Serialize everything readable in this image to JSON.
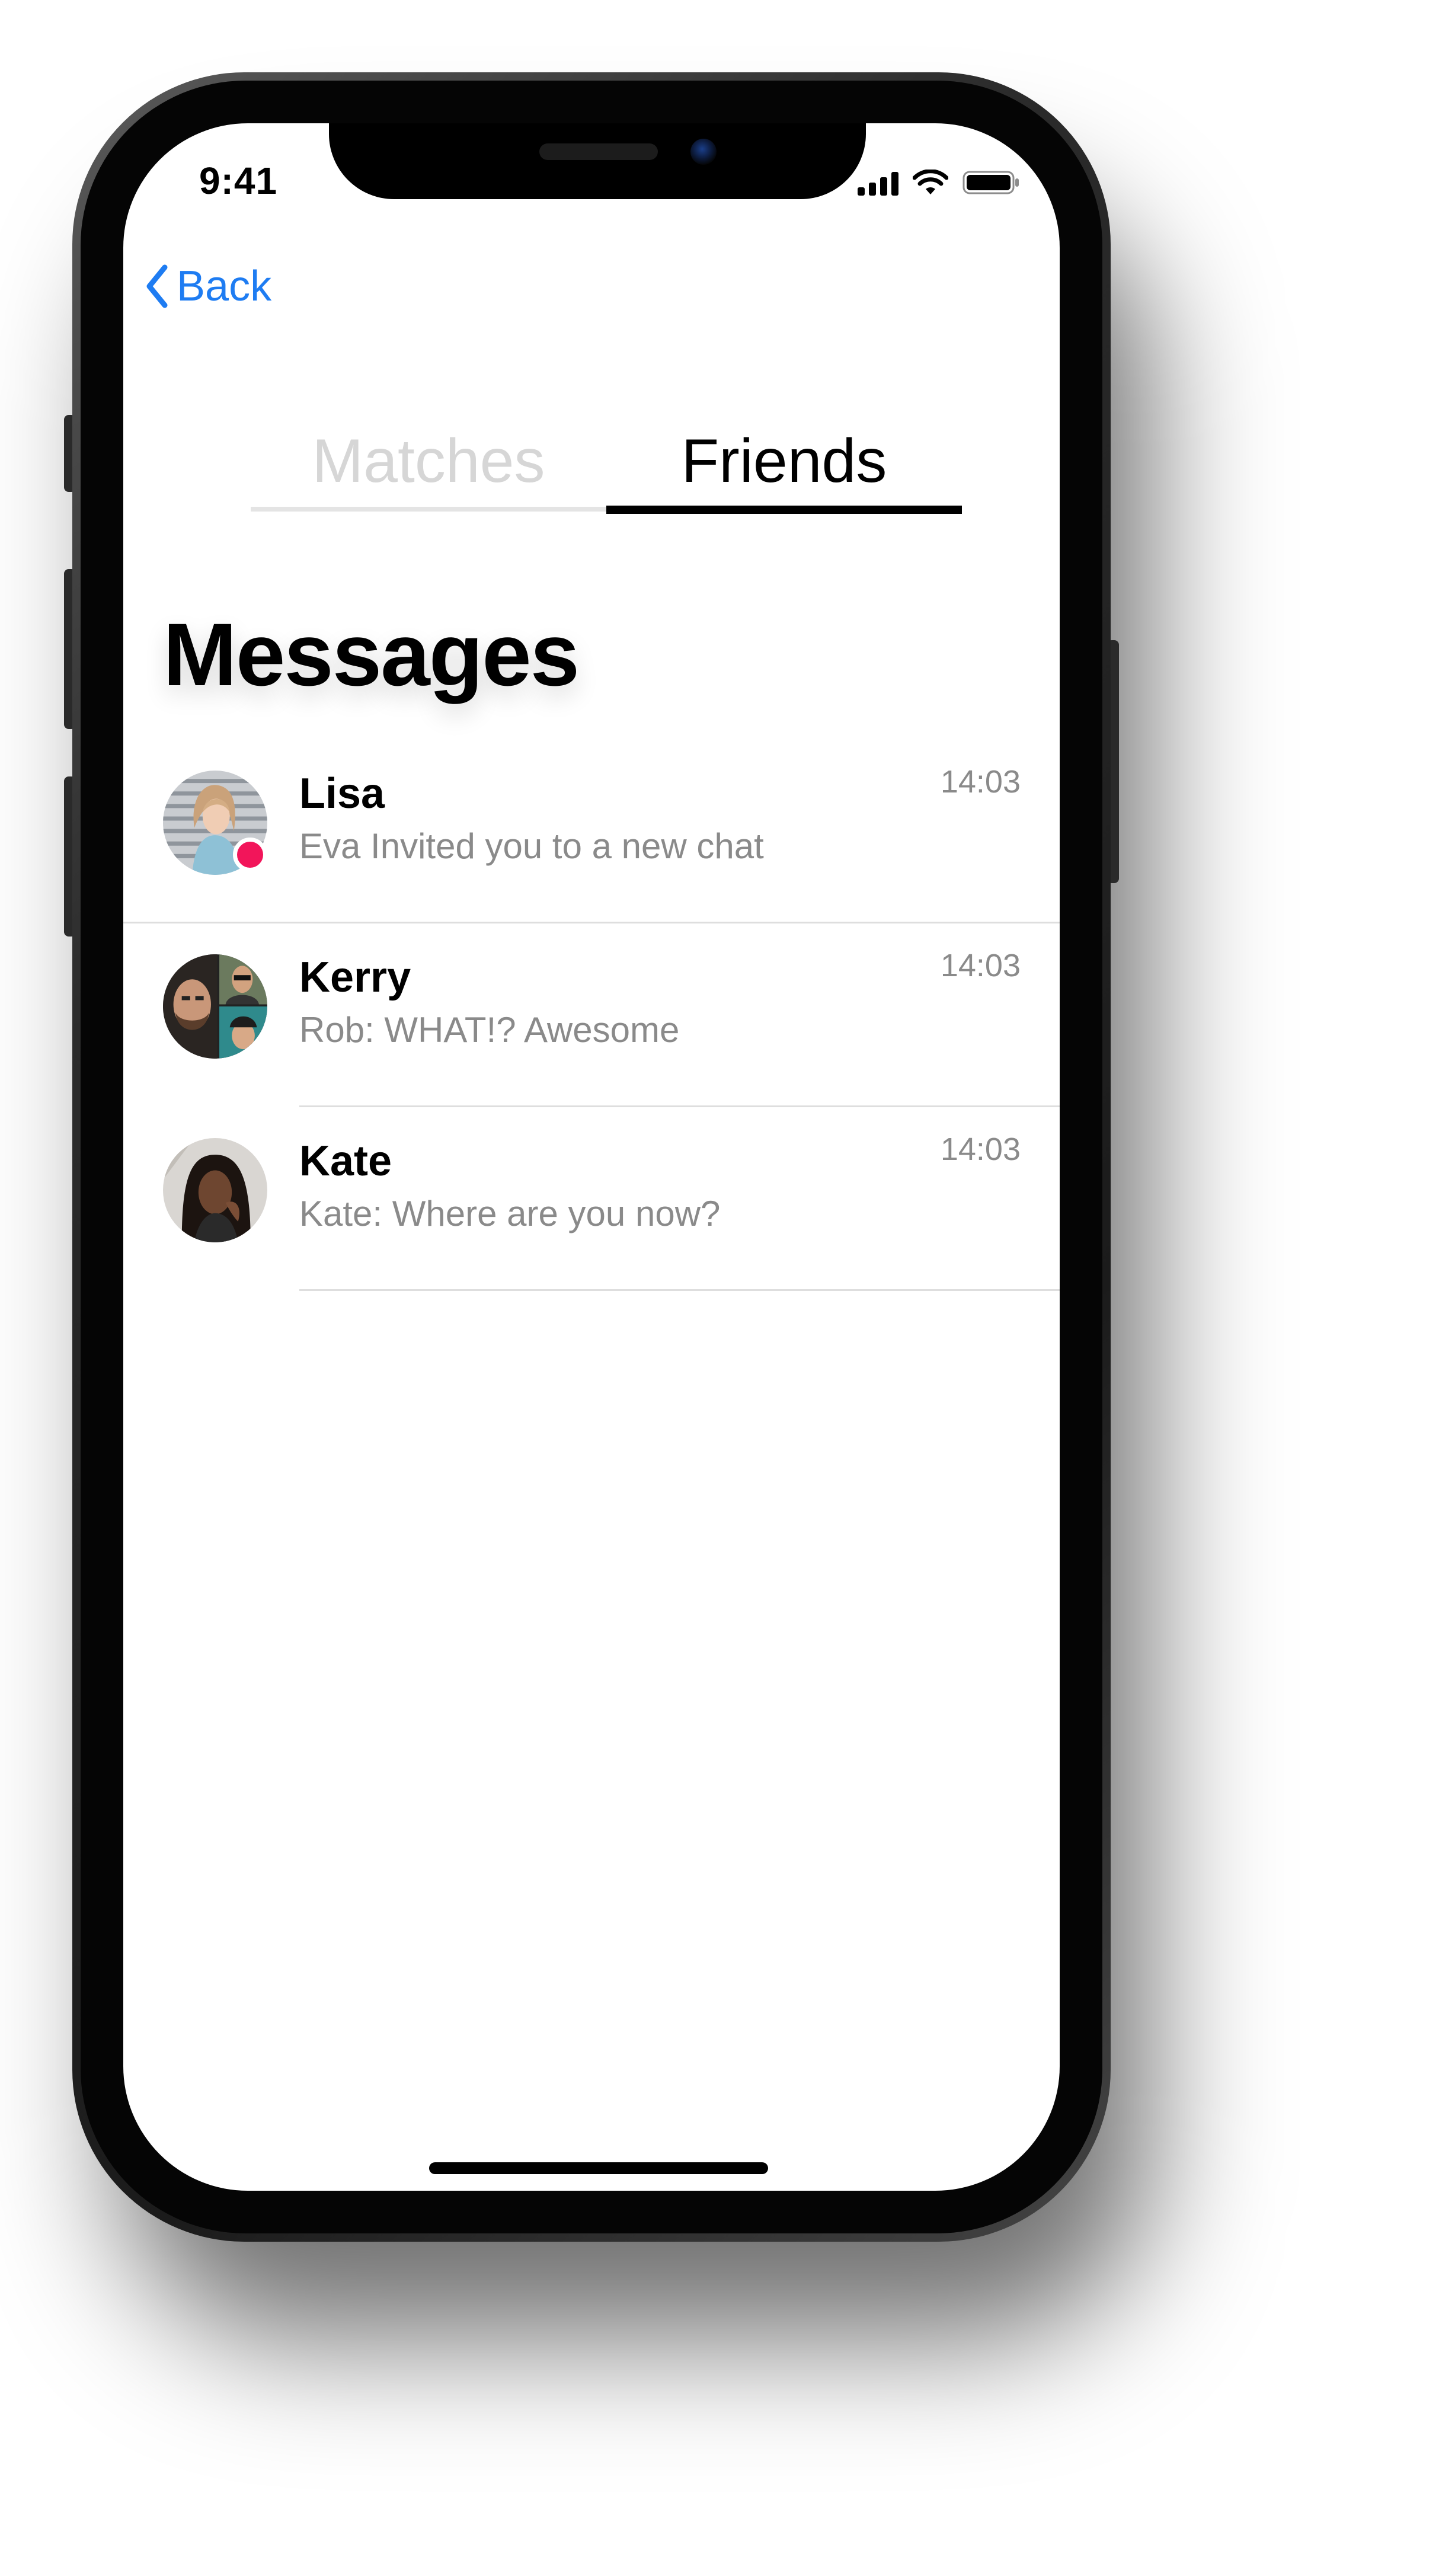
{
  "status_bar": {
    "time": "9:41",
    "signal_icon": "cellular-signal-icon",
    "wifi_icon": "wifi-icon",
    "battery_icon": "battery-icon"
  },
  "nav": {
    "back_label": "Back",
    "back_icon": "chevron-left-icon"
  },
  "tabs": [
    {
      "label": "Matches",
      "selected": false
    },
    {
      "label": "Friends",
      "selected": true
    }
  ],
  "title": "Messages",
  "messages": [
    {
      "name": "Lisa",
      "preview": "Eva Invited you to a new chat",
      "time": "14:03",
      "unread": true
    },
    {
      "name": "Kerry",
      "preview": "Rob: WHAT!? Awesome",
      "time": "14:03",
      "unread": false
    },
    {
      "name": "Kate",
      "preview": "Kate: Where are you now?",
      "time": "14:03",
      "unread": false
    }
  ],
  "colors": {
    "accent": "#1e7cf2",
    "unread_dot": "#f2155a",
    "secondary_text": "#8a8a8a",
    "inactive_tab": "#d6d6d6"
  }
}
